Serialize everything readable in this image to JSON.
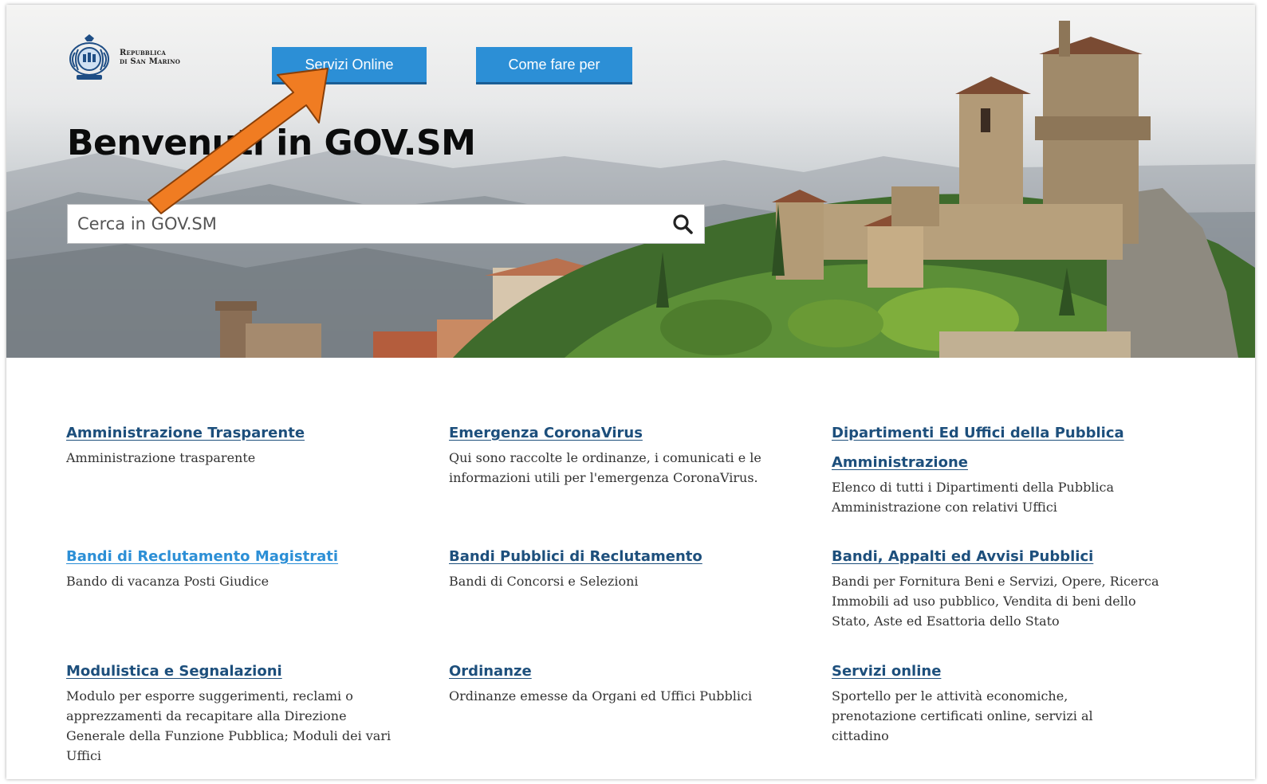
{
  "header": {
    "logo_line1": "Repubblica",
    "logo_line2": "di San Marino",
    "nav": [
      {
        "label": "Servizi Online"
      },
      {
        "label": "Come fare per"
      }
    ]
  },
  "hero": {
    "title": "Benvenuti in GOV.SM",
    "search_placeholder": "Cerca in GOV.SM"
  },
  "colors": {
    "nav_button": "#2c8fd6",
    "link": "#1d4f7c",
    "link_visited": "#2c8fd6",
    "arrow": "#f07c22"
  },
  "links": [
    {
      "title": "Amministrazione Trasparente",
      "desc": "Amministrazione trasparente"
    },
    {
      "title": "Emergenza CoronaVirus",
      "desc": "Qui sono raccolte le ordinanze, i comunicati e le informazioni utili per l'emergenza CoronaVirus."
    },
    {
      "title": "Dipartimenti Ed Uffici della Pubblica Amministrazione",
      "desc": "Elenco di tutti i Dipartimenti della Pubblica Amministrazione con relativi Uffici"
    },
    {
      "title": "Bandi di Reclutamento Magistrati",
      "desc": "Bando di vacanza Posti Giudice"
    },
    {
      "title": "Bandi Pubblici di Reclutamento",
      "desc": "Bandi di Concorsi e Selezioni"
    },
    {
      "title": "Bandi, Appalti ed Avvisi Pubblici",
      "desc": "Bandi per Fornitura Beni e Servizi, Opere, Ricerca Immobili ad uso pubblico, Vendita di beni dello Stato, Aste ed Esattoria dello Stato"
    },
    {
      "title": "Modulistica e Segnalazioni",
      "desc": "Modulo per esporre suggerimenti, reclami o apprezzamenti da recapitare alla Direzione Generale della Funzione Pubblica; Moduli dei vari Uffici"
    },
    {
      "title": "Ordinanze",
      "desc": "Ordinanze emesse da Organi ed Uffici Pubblici"
    },
    {
      "title": "Servizi online",
      "desc": "Sportello per le attività economiche, prenotazione certificati online, servizi al cittadino"
    }
  ]
}
